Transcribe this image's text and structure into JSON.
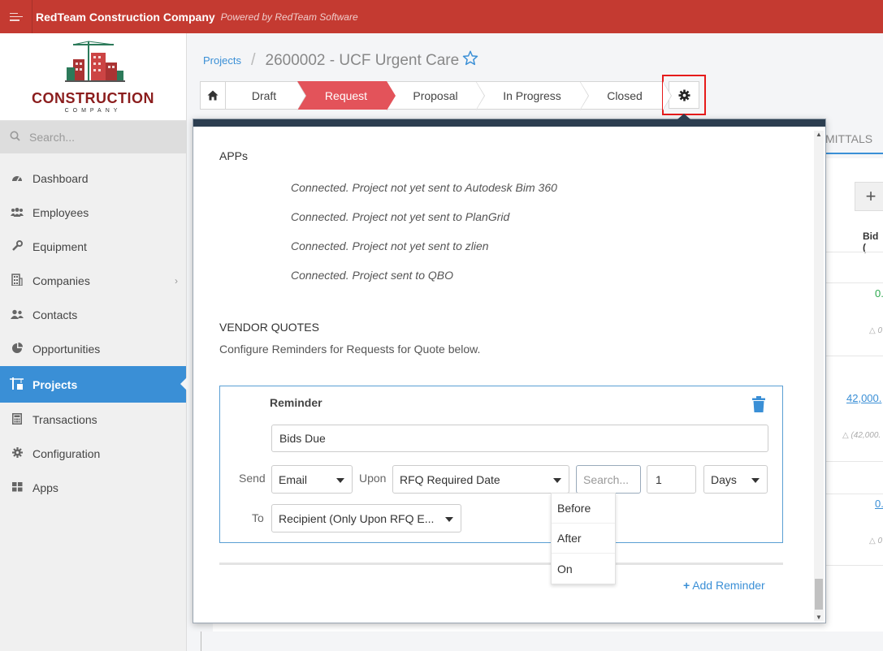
{
  "topbar": {
    "company": "RedTeam Construction Company",
    "powered": "Powered by RedTeam Software"
  },
  "logo": {
    "title": "CONSTRUCTION",
    "subtitle": "COMPANY"
  },
  "sidebar": {
    "search_placeholder": "Search...",
    "items": [
      {
        "label": "Dashboard",
        "icon": "dashboard-icon"
      },
      {
        "label": "Employees",
        "icon": "users-icon"
      },
      {
        "label": "Equipment",
        "icon": "wrench-icon"
      },
      {
        "label": "Companies",
        "icon": "building-icon"
      },
      {
        "label": "Contacts",
        "icon": "contacts-icon"
      },
      {
        "label": "Opportunities",
        "icon": "pie-chart-icon"
      },
      {
        "label": "Projects",
        "icon": "crane-icon"
      },
      {
        "label": "Transactions",
        "icon": "calculator-icon"
      },
      {
        "label": "Configuration",
        "icon": "gear-icon"
      },
      {
        "label": "Apps",
        "icon": "grid-icon"
      }
    ],
    "active": "Projects"
  },
  "breadcrumb": {
    "link": "Projects",
    "separator": "/",
    "title": "2600002 - UCF Urgent Care"
  },
  "pipeline": {
    "stages": [
      "Draft",
      "Request",
      "Proposal",
      "In Progress",
      "Closed"
    ],
    "active": "Request"
  },
  "background": {
    "tab_partial": "MITTALS",
    "bid_header": "Bid (",
    "values": [
      "0.",
      "42,000.",
      "0."
    ],
    "deltas": [
      "△ 0",
      "△ (42,000.",
      "△ 0"
    ]
  },
  "modal": {
    "apps_title": "APPs",
    "apps": [
      "Connected. Project not yet sent to Autodesk Bim 360",
      "Connected. Project not yet sent to PlanGrid",
      "Connected. Project not yet sent to zlien",
      "Connected. Project sent to QBO"
    ],
    "vendor_title": "VENDOR QUOTES",
    "vendor_desc": "Configure Reminders for Requests for Quote below.",
    "reminder": {
      "label": "Reminder",
      "name": "Bids Due",
      "send_label": "Send",
      "send_value": "Email",
      "upon_label": "Upon",
      "upon_value": "RFQ Required Date",
      "search_placeholder": "Search...",
      "number": "1",
      "unit": "Days",
      "to_label": "To",
      "to_value": "Recipient (Only Upon RFQ E..."
    },
    "dropdown_options": [
      "Before",
      "After",
      "On"
    ],
    "add_reminder": "Add Reminder"
  },
  "colors": {
    "topbar": "#c43a31",
    "accent": "#3a8fd6",
    "active_stage": "#e3535a",
    "highlight_border": "#e61b1b"
  }
}
